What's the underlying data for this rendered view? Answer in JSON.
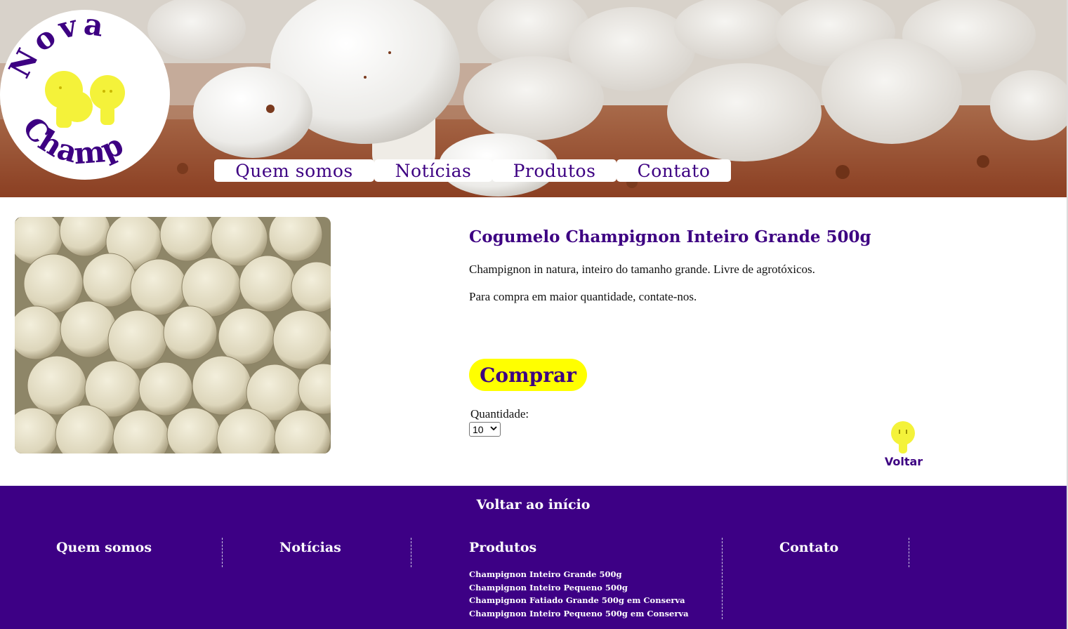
{
  "logo": {
    "line1": "Nova",
    "line2": "Champ"
  },
  "nav": {
    "items": [
      "Quem somos",
      "Notícias",
      "Produtos",
      "Contato"
    ]
  },
  "product": {
    "title": "Cogumelo Champignon Inteiro Grande 500g",
    "description": "Champignon in natura, inteiro do tamanho grande. Livre de agrotóxicos.",
    "note": "Para compra em maior quantidade, contate-nos.",
    "buy_label": "Comprar",
    "quantity_label": "Quantidade:",
    "quantity_value": "10",
    "back_label": "Voltar"
  },
  "footer": {
    "back_to_top": "Voltar ao início",
    "columns": [
      "Quem somos",
      "Notícias",
      "Produtos",
      "Contato"
    ],
    "product_links": [
      "Champignon Inteiro Grande 500g",
      "Champignon Inteiro Pequeno 500g",
      "Champignon Fatiado Grande 500g em Conserva",
      "Champignon Inteiro Pequeno 500g em Conserva"
    ]
  },
  "colors": {
    "brand_purple": "#3d0082",
    "footer_purple": "#3d0085",
    "accent_yellow": "#ffff00"
  }
}
